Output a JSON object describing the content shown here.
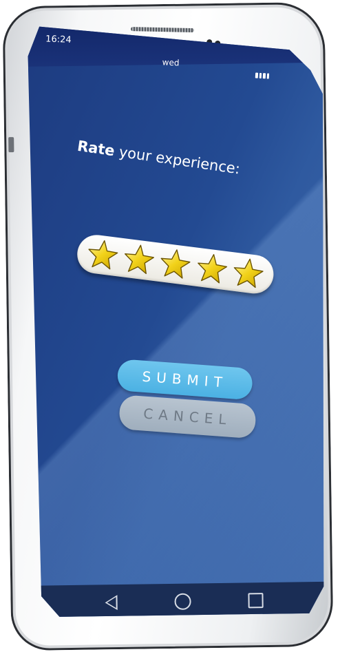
{
  "status_bar": {
    "time": "16:24",
    "day": "wed",
    "battery_icon": "battery-icon"
  },
  "rating": {
    "heading_bold": "Rate",
    "heading_rest": " your experience:",
    "stars_total": 5,
    "stars_selected": 5,
    "star_color": "#f2d21a"
  },
  "buttons": {
    "submit_label": "SUBMIT",
    "cancel_label": "CANCEL"
  },
  "nav_bar": {
    "back_icon": "back-triangle-icon",
    "home_icon": "home-circle-icon",
    "recents_icon": "recents-square-icon"
  },
  "colors": {
    "screen_blue": "#234a92",
    "submit_blue": "#4bb1e3",
    "cancel_gray": "#9faebd"
  }
}
